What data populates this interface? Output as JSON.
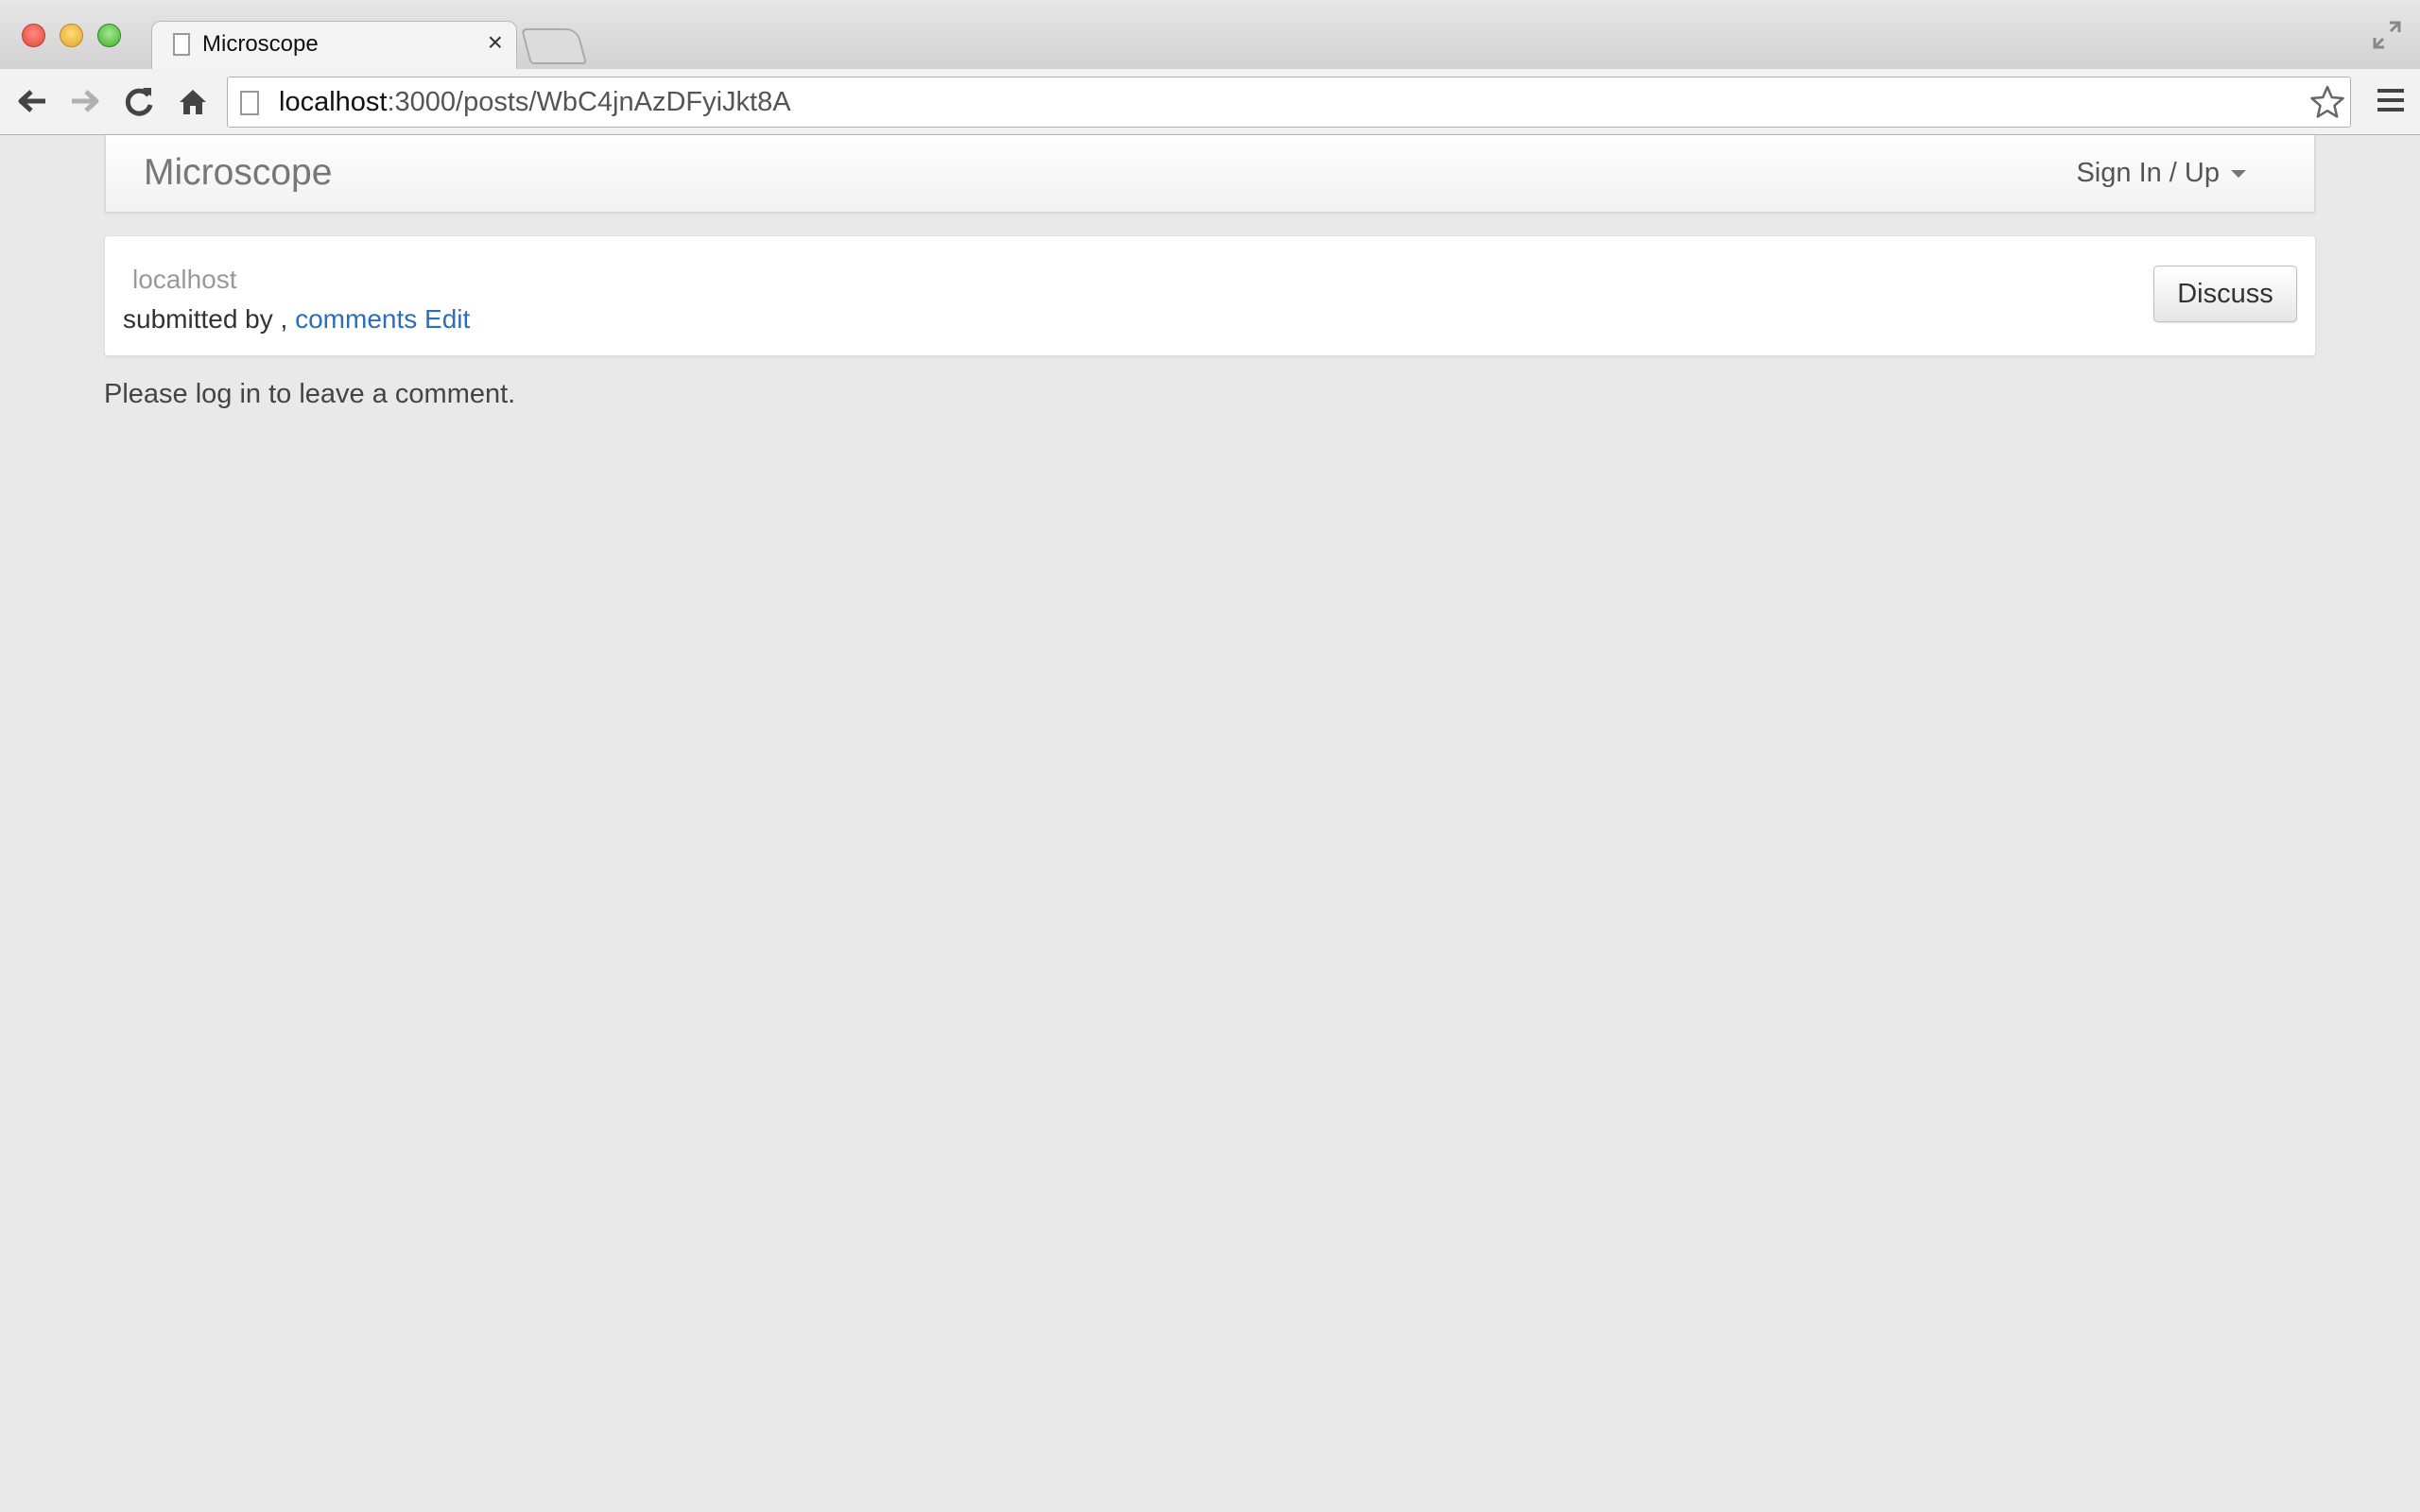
{
  "browser": {
    "tab_title": "Microscope",
    "tab_close": "×",
    "url_host": "localhost",
    "url_path": ":3000/posts/WbC4jnAzDFyiJkt8A"
  },
  "navbar": {
    "brand": "Microscope",
    "signin_label": "Sign In / Up"
  },
  "post": {
    "domain": "localhost",
    "submitted_prefix": "submitted by , ",
    "comments_link": "comments",
    "edit_link": "Edit",
    "discuss_label": "Discuss"
  },
  "comments": {
    "login_message": "Please log in to leave a comment."
  },
  "colors": {
    "link": "#2a6fbd",
    "page_background": "#e9e9e9"
  }
}
